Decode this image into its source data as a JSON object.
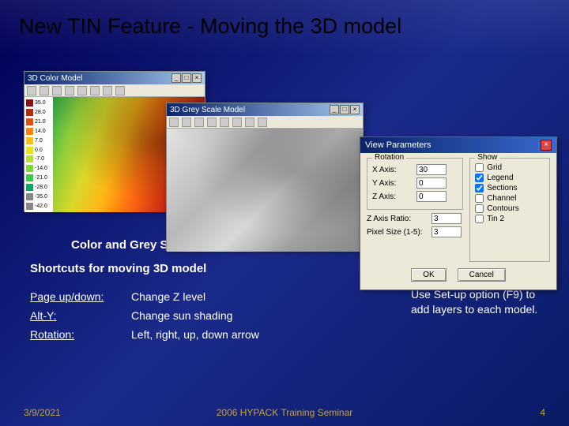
{
  "title": "New TIN Feature - Moving the 3D model",
  "window_color": {
    "title": "3D Color Model"
  },
  "window_grey": {
    "title": "3D Grey Scale Model"
  },
  "legend_values": [
    "35.0",
    "28.0",
    "21.0",
    "14.0",
    "7.0",
    "0.0",
    "-7.0",
    "-14.0",
    "-21.0",
    "-28.0",
    "-35.0",
    "-42.0"
  ],
  "legend_colors": [
    "#8a1010",
    "#b82810",
    "#e05010",
    "#ff8510",
    "#ffc015",
    "#e8e020",
    "#b8e028",
    "#80d838",
    "#40c848",
    "#0aa860",
    "#878787",
    "#878787"
  ],
  "caption_models": "Color and Grey Scale model",
  "shortcut_header": "Shortcuts for moving 3D model",
  "shortcuts": [
    {
      "key": "Page up/down:",
      "val": "Change Z level"
    },
    {
      "key": "Alt-Y:",
      "val": "Change sun shading"
    },
    {
      "key": "Rotation:",
      "val": "Left, right, up, down arrow"
    }
  ],
  "setup_note": "Use Set-up option (F9) to add layers to each model.",
  "dialog": {
    "title": "View Parameters",
    "rotation_label": "Rotation",
    "show_label": "Show",
    "xaxis_label": "X Axis:",
    "yaxis_label": "Y Axis:",
    "zaxis_label": "Z Axis:",
    "xaxis_val": "30",
    "yaxis_val": "0",
    "zaxis_val": "0",
    "zratio_label": "Z Axis Ratio:",
    "zratio_val": "3",
    "pixel_label": "Pixel Size (1-5):",
    "pixel_val": "3",
    "show_items": [
      {
        "label": "Grid",
        "checked": false
      },
      {
        "label": "Legend",
        "checked": true
      },
      {
        "label": "Sections",
        "checked": true
      },
      {
        "label": "Channel",
        "checked": false
      },
      {
        "label": "Contours",
        "checked": false
      },
      {
        "label": "Tin 2",
        "checked": false
      }
    ],
    "ok": "OK",
    "cancel": "Cancel"
  },
  "footer": {
    "date": "3/9/2021",
    "center": "2006 HYPACK Training Seminar",
    "page": "4"
  }
}
